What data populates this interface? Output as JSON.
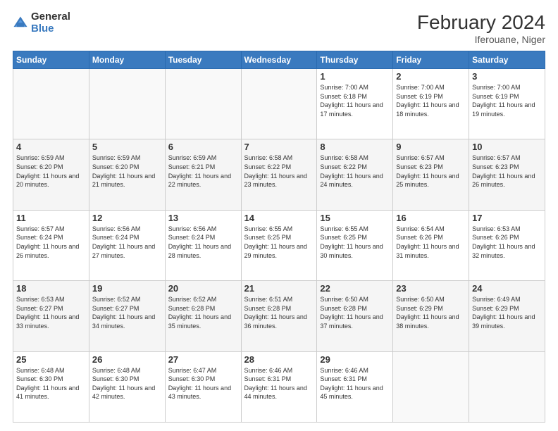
{
  "logo": {
    "general": "General",
    "blue": "Blue"
  },
  "title": {
    "month_year": "February 2024",
    "location": "Iferouane, Niger"
  },
  "days_of_week": [
    "Sunday",
    "Monday",
    "Tuesday",
    "Wednesday",
    "Thursday",
    "Friday",
    "Saturday"
  ],
  "weeks": [
    [
      {
        "day": "",
        "sunrise": "",
        "sunset": "",
        "daylight": "",
        "empty": true
      },
      {
        "day": "",
        "sunrise": "",
        "sunset": "",
        "daylight": "",
        "empty": true
      },
      {
        "day": "",
        "sunrise": "",
        "sunset": "",
        "daylight": "",
        "empty": true
      },
      {
        "day": "",
        "sunrise": "",
        "sunset": "",
        "daylight": "",
        "empty": true
      },
      {
        "day": "1",
        "sunrise": "7:00 AM",
        "sunset": "6:18 PM",
        "daylight": "11 hours and 17 minutes."
      },
      {
        "day": "2",
        "sunrise": "7:00 AM",
        "sunset": "6:19 PM",
        "daylight": "11 hours and 18 minutes."
      },
      {
        "day": "3",
        "sunrise": "7:00 AM",
        "sunset": "6:19 PM",
        "daylight": "11 hours and 19 minutes."
      }
    ],
    [
      {
        "day": "4",
        "sunrise": "6:59 AM",
        "sunset": "6:20 PM",
        "daylight": "11 hours and 20 minutes."
      },
      {
        "day": "5",
        "sunrise": "6:59 AM",
        "sunset": "6:20 PM",
        "daylight": "11 hours and 21 minutes."
      },
      {
        "day": "6",
        "sunrise": "6:59 AM",
        "sunset": "6:21 PM",
        "daylight": "11 hours and 22 minutes."
      },
      {
        "day": "7",
        "sunrise": "6:58 AM",
        "sunset": "6:22 PM",
        "daylight": "11 hours and 23 minutes."
      },
      {
        "day": "8",
        "sunrise": "6:58 AM",
        "sunset": "6:22 PM",
        "daylight": "11 hours and 24 minutes."
      },
      {
        "day": "9",
        "sunrise": "6:57 AM",
        "sunset": "6:23 PM",
        "daylight": "11 hours and 25 minutes."
      },
      {
        "day": "10",
        "sunrise": "6:57 AM",
        "sunset": "6:23 PM",
        "daylight": "11 hours and 26 minutes."
      }
    ],
    [
      {
        "day": "11",
        "sunrise": "6:57 AM",
        "sunset": "6:24 PM",
        "daylight": "11 hours and 26 minutes."
      },
      {
        "day": "12",
        "sunrise": "6:56 AM",
        "sunset": "6:24 PM",
        "daylight": "11 hours and 27 minutes."
      },
      {
        "day": "13",
        "sunrise": "6:56 AM",
        "sunset": "6:24 PM",
        "daylight": "11 hours and 28 minutes."
      },
      {
        "day": "14",
        "sunrise": "6:55 AM",
        "sunset": "6:25 PM",
        "daylight": "11 hours and 29 minutes."
      },
      {
        "day": "15",
        "sunrise": "6:55 AM",
        "sunset": "6:25 PM",
        "daylight": "11 hours and 30 minutes."
      },
      {
        "day": "16",
        "sunrise": "6:54 AM",
        "sunset": "6:26 PM",
        "daylight": "11 hours and 31 minutes."
      },
      {
        "day": "17",
        "sunrise": "6:53 AM",
        "sunset": "6:26 PM",
        "daylight": "11 hours and 32 minutes."
      }
    ],
    [
      {
        "day": "18",
        "sunrise": "6:53 AM",
        "sunset": "6:27 PM",
        "daylight": "11 hours and 33 minutes."
      },
      {
        "day": "19",
        "sunrise": "6:52 AM",
        "sunset": "6:27 PM",
        "daylight": "11 hours and 34 minutes."
      },
      {
        "day": "20",
        "sunrise": "6:52 AM",
        "sunset": "6:28 PM",
        "daylight": "11 hours and 35 minutes."
      },
      {
        "day": "21",
        "sunrise": "6:51 AM",
        "sunset": "6:28 PM",
        "daylight": "11 hours and 36 minutes."
      },
      {
        "day": "22",
        "sunrise": "6:50 AM",
        "sunset": "6:28 PM",
        "daylight": "11 hours and 37 minutes."
      },
      {
        "day": "23",
        "sunrise": "6:50 AM",
        "sunset": "6:29 PM",
        "daylight": "11 hours and 38 minutes."
      },
      {
        "day": "24",
        "sunrise": "6:49 AM",
        "sunset": "6:29 PM",
        "daylight": "11 hours and 39 minutes."
      }
    ],
    [
      {
        "day": "25",
        "sunrise": "6:48 AM",
        "sunset": "6:30 PM",
        "daylight": "11 hours and 41 minutes."
      },
      {
        "day": "26",
        "sunrise": "6:48 AM",
        "sunset": "6:30 PM",
        "daylight": "11 hours and 42 minutes."
      },
      {
        "day": "27",
        "sunrise": "6:47 AM",
        "sunset": "6:30 PM",
        "daylight": "11 hours and 43 minutes."
      },
      {
        "day": "28",
        "sunrise": "6:46 AM",
        "sunset": "6:31 PM",
        "daylight": "11 hours and 44 minutes."
      },
      {
        "day": "29",
        "sunrise": "6:46 AM",
        "sunset": "6:31 PM",
        "daylight": "11 hours and 45 minutes."
      },
      {
        "day": "",
        "sunrise": "",
        "sunset": "",
        "daylight": "",
        "empty": true
      },
      {
        "day": "",
        "sunrise": "",
        "sunset": "",
        "daylight": "",
        "empty": true
      }
    ]
  ],
  "labels": {
    "sunrise": "Sunrise:",
    "sunset": "Sunset:",
    "daylight": "Daylight:"
  }
}
